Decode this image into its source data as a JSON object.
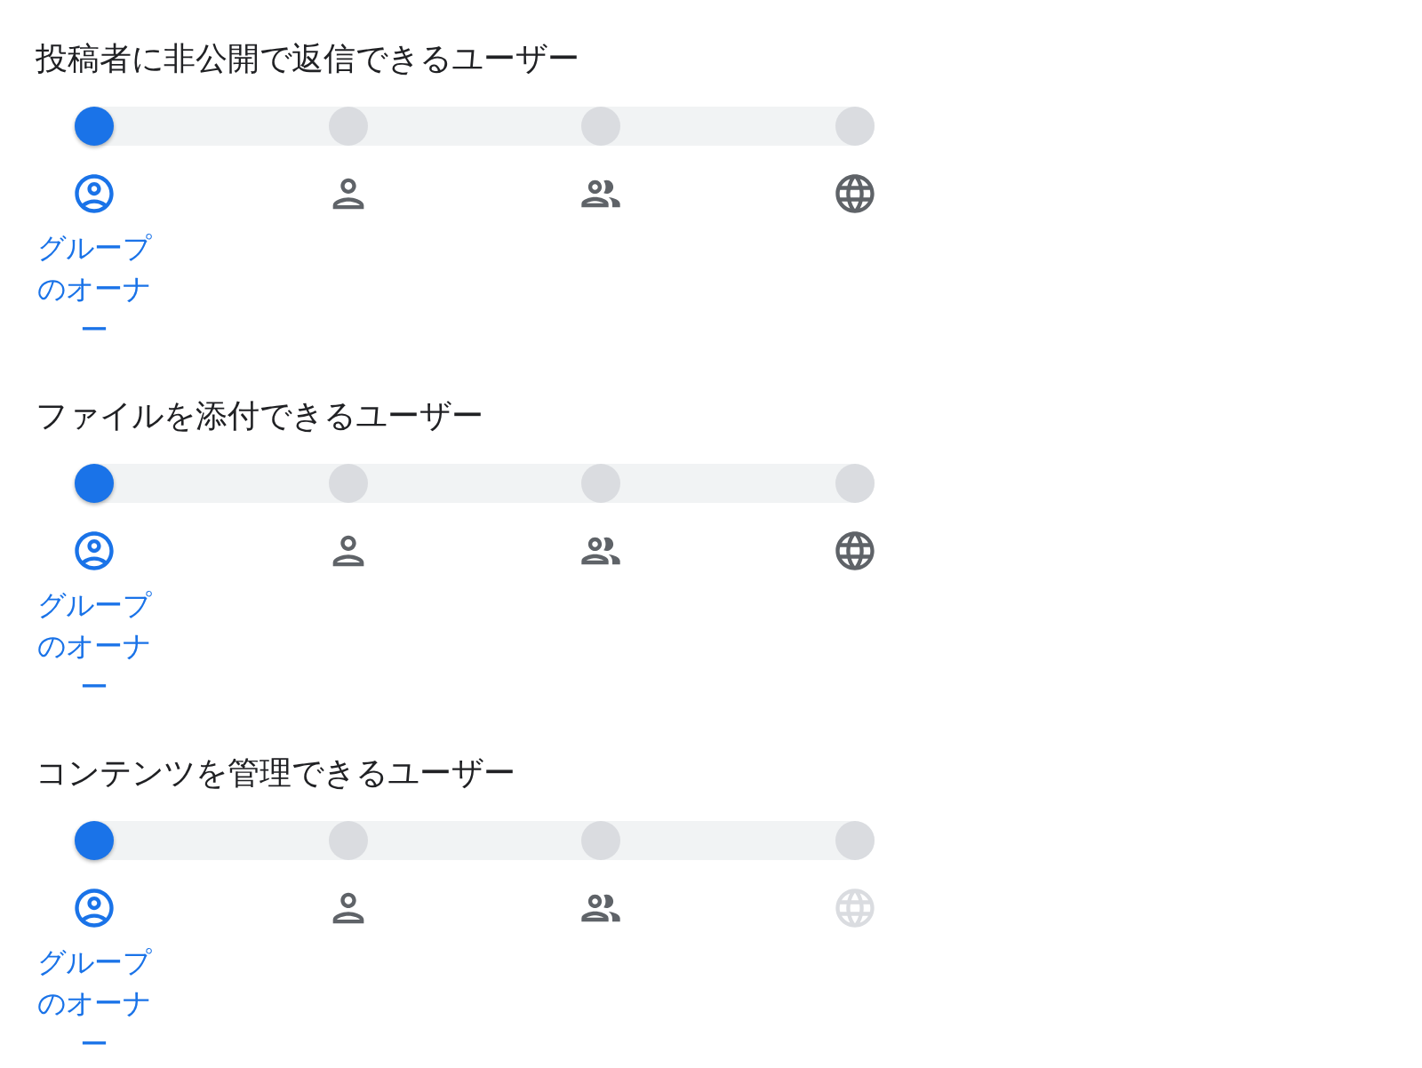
{
  "sections": [
    {
      "title": "投稿者に非公開で返信できるユーザー",
      "options": [
        {
          "kind": "owner",
          "selected": true,
          "disabled": false,
          "label": "グループのオーナー"
        },
        {
          "kind": "person",
          "selected": false,
          "disabled": false
        },
        {
          "kind": "people",
          "selected": false,
          "disabled": false
        },
        {
          "kind": "globe",
          "selected": false,
          "disabled": false
        }
      ]
    },
    {
      "title": "ファイルを添付できるユーザー",
      "options": [
        {
          "kind": "owner",
          "selected": true,
          "disabled": false,
          "label": "グループのオーナー"
        },
        {
          "kind": "person",
          "selected": false,
          "disabled": false
        },
        {
          "kind": "people",
          "selected": false,
          "disabled": false
        },
        {
          "kind": "globe",
          "selected": false,
          "disabled": false
        }
      ]
    },
    {
      "title": "コンテンツを管理できるユーザー",
      "options": [
        {
          "kind": "owner",
          "selected": true,
          "disabled": false,
          "label": "グループのオーナー"
        },
        {
          "kind": "person",
          "selected": false,
          "disabled": false
        },
        {
          "kind": "people",
          "selected": false,
          "disabled": false
        },
        {
          "kind": "globe",
          "selected": false,
          "disabled": true
        }
      ]
    }
  ]
}
